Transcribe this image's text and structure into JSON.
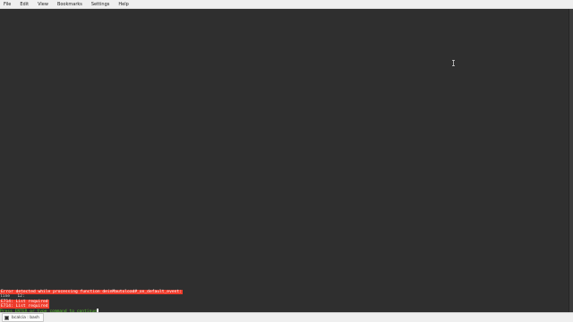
{
  "menu": {
    "file": "File",
    "edit": "Edit",
    "view": "View",
    "bookmarks": "Bookmarks",
    "settings": "Settings",
    "help": "Help"
  },
  "terminal": {
    "lines": [
      "Error detected while processing function deinMautoload#_on_default_event:",
      "line   12:",
      "E714: List required",
      "E714: List required",
      "Press ENTER or type command to continue"
    ]
  },
  "taskbar": {
    "tab_label": "bcalcia : bash"
  },
  "colors": {
    "background": "#2f2f2f",
    "error_bg": "#ee3b2b",
    "prompt": "#57c22c"
  }
}
